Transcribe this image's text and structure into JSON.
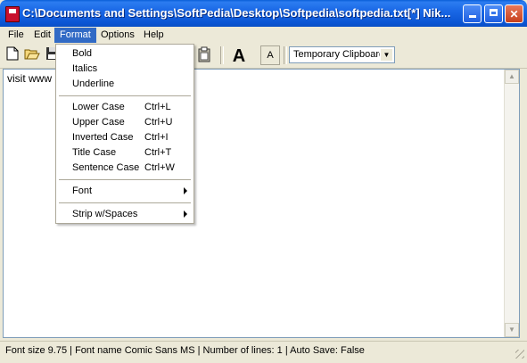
{
  "window": {
    "title": "C:\\Documents and Settings\\SoftPedia\\Desktop\\Softpedia\\softpedia.txt[*] Nik...",
    "min_icon": "minimize-icon",
    "max_icon": "maximize-icon",
    "close_glyph": "✕"
  },
  "menubar": {
    "items": [
      "File",
      "Edit",
      "Format",
      "Options",
      "Help"
    ],
    "active": "Format"
  },
  "toolbar": {
    "icons": [
      "new-document-icon",
      "open-folder-icon",
      "save-icon",
      "clipboard-icon"
    ],
    "big_font_label": "A",
    "small_font_label": "A",
    "clipboard_combo": "Temporary Clipboard",
    "combo_arrow": "▼"
  },
  "editor": {
    "text": "visit www"
  },
  "format_menu": {
    "items": [
      {
        "label": "Bold",
        "shortcut": ""
      },
      {
        "label": "Italics",
        "shortcut": ""
      },
      {
        "label": "Underline",
        "shortcut": ""
      },
      {
        "label": "Lower Case",
        "shortcut": "Ctrl+L"
      },
      {
        "label": "Upper Case",
        "shortcut": "Ctrl+U"
      },
      {
        "label": "Inverted Case",
        "shortcut": "Ctrl+I"
      },
      {
        "label": "Title Case",
        "shortcut": "Ctrl+T"
      },
      {
        "label": "Sentence Case",
        "shortcut": "Ctrl+W"
      },
      {
        "label": "Font",
        "shortcut": "",
        "submenu": true
      },
      {
        "label": "Strip w/Spaces",
        "shortcut": "",
        "submenu": true
      }
    ]
  },
  "statusbar": {
    "text": "Font size 9.75  |  Font name Comic Sans MS  |  Number of lines:  1  |  Auto Save: False"
  },
  "scrollbar": {
    "up": "▲",
    "down": "▼"
  },
  "colors": {
    "titlebar": "#0b55d4",
    "menu_highlight": "#316ac5",
    "window_bg": "#ece9d8"
  }
}
